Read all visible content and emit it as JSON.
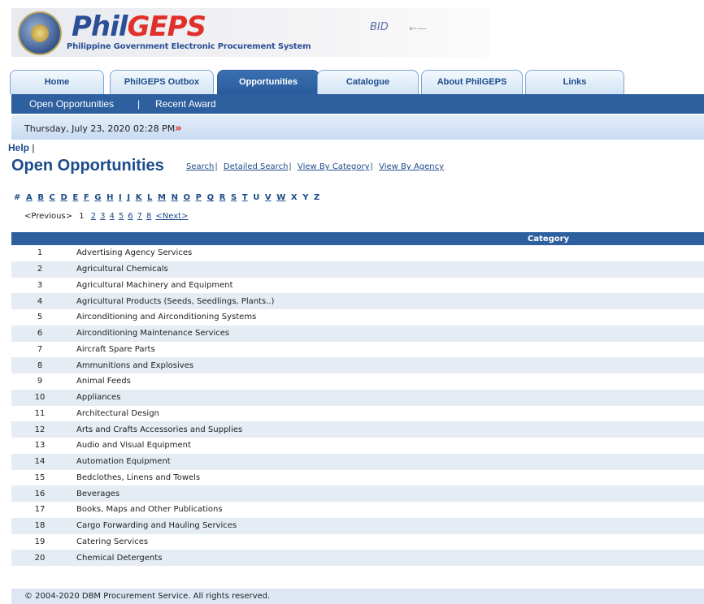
{
  "header": {
    "logo_prefix": "Phil",
    "logo_suffix": "GEPS",
    "logo_subtitle": "Philippine Government Electronic Procurement System",
    "tagline": "BID"
  },
  "tabs": [
    {
      "label": "Home",
      "active": false
    },
    {
      "label": "PhilGEPS Outbox",
      "active": false
    },
    {
      "label": "Opportunities",
      "active": true
    },
    {
      "label": "Catalogue",
      "active": false
    },
    {
      "label": "About PhilGEPS",
      "active": false
    },
    {
      "label": "Links",
      "active": false
    }
  ],
  "subnav": {
    "open_opportunities": "Open Opportunities",
    "separator": "|",
    "recent_award": "Recent Award"
  },
  "datebar": {
    "date": "Thursday, July 23, 2020 02:28 PM",
    "chevron": "»"
  },
  "help": {
    "label": "Help",
    "separator": "|"
  },
  "page": {
    "title": "Open Opportunities",
    "links": {
      "search": "Search",
      "detailed_search": "Detailed Search",
      "view_by_category": "View By Category",
      "view_by_agency": "View By Agency"
    }
  },
  "alphabet": [
    "#",
    "A",
    "B",
    "C",
    "D",
    "E",
    "F",
    "G",
    "H",
    "I",
    "J",
    "K",
    "L",
    "M",
    "N",
    "O",
    "P",
    "Q",
    "R",
    "S",
    "T",
    "U",
    "V",
    "W",
    "X",
    "Y",
    "Z"
  ],
  "pager": {
    "previous": "<Previous>",
    "current": "1",
    "pages": [
      "2",
      "3",
      "4",
      "5",
      "6",
      "7",
      "8"
    ],
    "next": "<Next>"
  },
  "table": {
    "header": {
      "category": "Category"
    },
    "rows": [
      {
        "num": "1",
        "category": "Advertising Agency Services"
      },
      {
        "num": "2",
        "category": "Agricultural Chemicals"
      },
      {
        "num": "3",
        "category": "Agricultural Machinery and Equipment"
      },
      {
        "num": "4",
        "category": "Agricultural Products (Seeds, Seedlings, Plants..)"
      },
      {
        "num": "5",
        "category": "Airconditioning and Airconditioning Systems"
      },
      {
        "num": "6",
        "category": "Airconditioning Maintenance Services"
      },
      {
        "num": "7",
        "category": "Aircraft Spare Parts"
      },
      {
        "num": "8",
        "category": "Ammunitions and Explosives"
      },
      {
        "num": "9",
        "category": "Animal Feeds"
      },
      {
        "num": "10",
        "category": "Appliances"
      },
      {
        "num": "11",
        "category": "Architectural Design"
      },
      {
        "num": "12",
        "category": "Arts and Crafts Accessories and Supplies"
      },
      {
        "num": "13",
        "category": "Audio and Visual Equipment"
      },
      {
        "num": "14",
        "category": "Automation Equipment"
      },
      {
        "num": "15",
        "category": "Bedclothes, Linens and Towels"
      },
      {
        "num": "16",
        "category": "Beverages"
      },
      {
        "num": "17",
        "category": "Books, Maps and Other Publications"
      },
      {
        "num": "18",
        "category": "Cargo Forwarding and Hauling Services"
      },
      {
        "num": "19",
        "category": "Catering Services"
      },
      {
        "num": "20",
        "category": "Chemical Detergents"
      }
    ]
  },
  "footer": {
    "text": "© 2004-2020  DBM Procurement Service. All rights reserved."
  },
  "colors": {
    "brand_blue": "#1c4c8a",
    "nav_blue": "#2e5f9f",
    "alt_row": "#e6ecf3",
    "accent_red": "#e02020"
  }
}
